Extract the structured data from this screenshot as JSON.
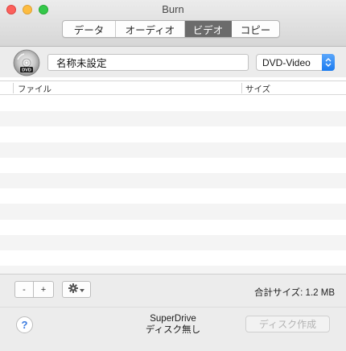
{
  "window": {
    "title": "Burn"
  },
  "tabs": [
    {
      "label": "データ",
      "active": false
    },
    {
      "label": "オーディオ",
      "active": false
    },
    {
      "label": "ビデオ",
      "active": true
    },
    {
      "label": "コピー",
      "active": false
    }
  ],
  "project": {
    "icon": "dvd-disc-icon",
    "name_value": "名称未設定",
    "format_selected": "DVD-Video"
  },
  "file_table": {
    "columns": [
      "ファイル",
      "サイズ"
    ],
    "rows": []
  },
  "footer": {
    "remove_label": "-",
    "add_label": "+",
    "action_icon": "gear-icon",
    "total_size_label": "合計サイズ: 1.2 MB",
    "help_label": "?",
    "drive_name": "SuperDrive",
    "drive_status": "ディスク無し",
    "burn_label": "ディスク作成",
    "burn_enabled": false
  }
}
